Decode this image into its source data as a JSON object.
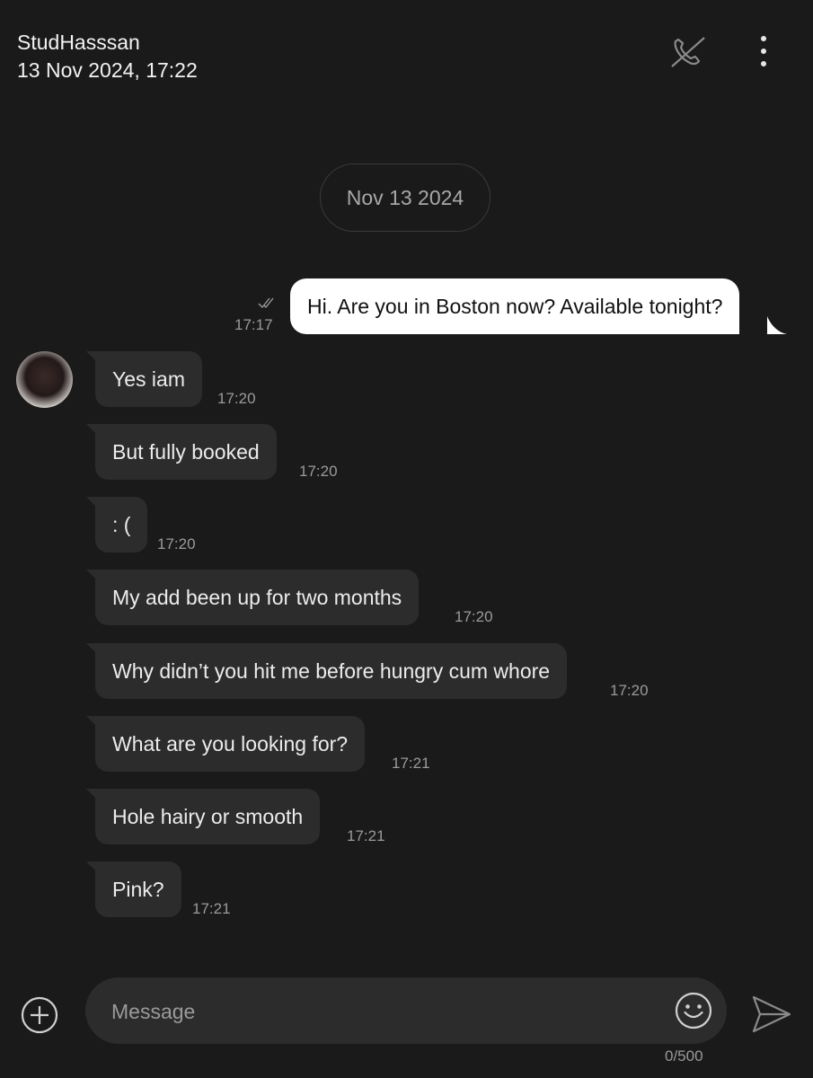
{
  "header": {
    "contact_name": "StudHasssan",
    "subtitle": "13 Nov 2024, 17:22",
    "call_icon": "call-disabled-icon",
    "menu_icon": "more-vertical-icon"
  },
  "date_separator": "Nov 13 2024",
  "outgoing": {
    "text": "Hi. Are you in Boston now? Available tonight?",
    "time": "17:17",
    "status_icon": "read-check-icon"
  },
  "incoming": [
    {
      "text": "Yes iam",
      "time": "17:20"
    },
    {
      "text": "But fully booked",
      "time": "17:20"
    },
    {
      "text": ": (",
      "time": "17:20"
    },
    {
      "text": "My add been up for two months",
      "time": "17:20"
    },
    {
      "text": "Why didn’t you hit me before hungry cum whore",
      "time": "17:20"
    },
    {
      "text": "What are you looking for?",
      "time": "17:21"
    },
    {
      "text": "Hole hairy or smooth",
      "time": "17:21"
    },
    {
      "text": "Pink?",
      "time": "17:21"
    }
  ],
  "composer": {
    "placeholder": "Message",
    "counter": "0/500",
    "attach_icon": "add-circle-icon",
    "emoji_icon": "emoji-icon",
    "send_icon": "send-icon"
  },
  "colors": {
    "background": "#1a1a1a",
    "incoming_bubble": "#2c2c2c",
    "outgoing_bubble": "#ffffff",
    "timestamp": "#9a9a9a"
  }
}
